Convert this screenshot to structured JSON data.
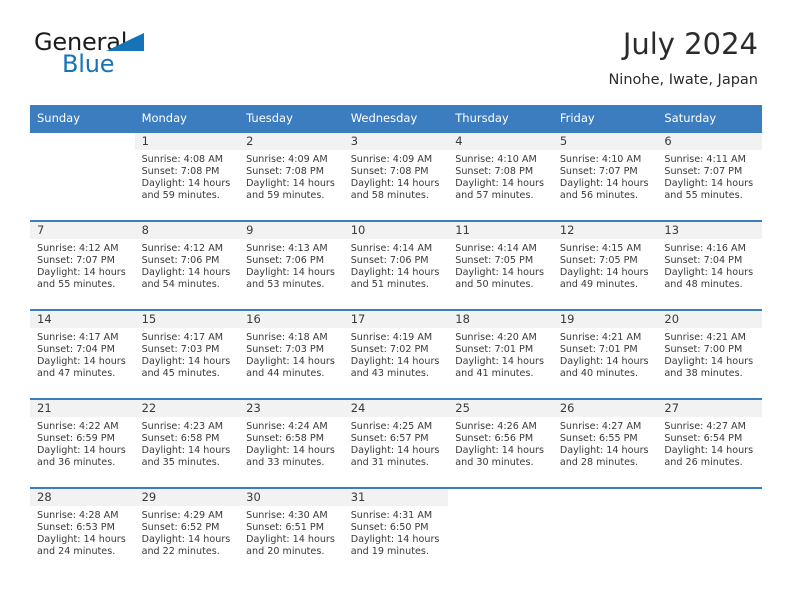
{
  "brand": {
    "line1": "General",
    "line2": "Blue",
    "triangle_icon": "triangle-icon",
    "color_dark": "#1c1c1c",
    "color_blue": "#1574b7"
  },
  "header": {
    "title": "July 2024",
    "location": "Ninohe, Iwate, Japan"
  },
  "theme": {
    "header_blue": "#3c7dc0",
    "daynum_band": "#f2f2f2",
    "text": "#3a3a3a"
  },
  "calendar": {
    "weekdays": [
      "Sunday",
      "Monday",
      "Tuesday",
      "Wednesday",
      "Thursday",
      "Friday",
      "Saturday"
    ],
    "weeks": [
      [
        {
          "day": "",
          "sunrise": "",
          "sunset": "",
          "daylight1": "",
          "daylight2": "",
          "blank": true
        },
        {
          "day": "1",
          "sunrise": "Sunrise: 4:08 AM",
          "sunset": "Sunset: 7:08 PM",
          "daylight1": "Daylight: 14 hours",
          "daylight2": "and 59 minutes."
        },
        {
          "day": "2",
          "sunrise": "Sunrise: 4:09 AM",
          "sunset": "Sunset: 7:08 PM",
          "daylight1": "Daylight: 14 hours",
          "daylight2": "and 59 minutes."
        },
        {
          "day": "3",
          "sunrise": "Sunrise: 4:09 AM",
          "sunset": "Sunset: 7:08 PM",
          "daylight1": "Daylight: 14 hours",
          "daylight2": "and 58 minutes."
        },
        {
          "day": "4",
          "sunrise": "Sunrise: 4:10 AM",
          "sunset": "Sunset: 7:08 PM",
          "daylight1": "Daylight: 14 hours",
          "daylight2": "and 57 minutes."
        },
        {
          "day": "5",
          "sunrise": "Sunrise: 4:10 AM",
          "sunset": "Sunset: 7:07 PM",
          "daylight1": "Daylight: 14 hours",
          "daylight2": "and 56 minutes."
        },
        {
          "day": "6",
          "sunrise": "Sunrise: 4:11 AM",
          "sunset": "Sunset: 7:07 PM",
          "daylight1": "Daylight: 14 hours",
          "daylight2": "and 55 minutes."
        }
      ],
      [
        {
          "day": "7",
          "sunrise": "Sunrise: 4:12 AM",
          "sunset": "Sunset: 7:07 PM",
          "daylight1": "Daylight: 14 hours",
          "daylight2": "and 55 minutes."
        },
        {
          "day": "8",
          "sunrise": "Sunrise: 4:12 AM",
          "sunset": "Sunset: 7:06 PM",
          "daylight1": "Daylight: 14 hours",
          "daylight2": "and 54 minutes."
        },
        {
          "day": "9",
          "sunrise": "Sunrise: 4:13 AM",
          "sunset": "Sunset: 7:06 PM",
          "daylight1": "Daylight: 14 hours",
          "daylight2": "and 53 minutes."
        },
        {
          "day": "10",
          "sunrise": "Sunrise: 4:14 AM",
          "sunset": "Sunset: 7:06 PM",
          "daylight1": "Daylight: 14 hours",
          "daylight2": "and 51 minutes."
        },
        {
          "day": "11",
          "sunrise": "Sunrise: 4:14 AM",
          "sunset": "Sunset: 7:05 PM",
          "daylight1": "Daylight: 14 hours",
          "daylight2": "and 50 minutes."
        },
        {
          "day": "12",
          "sunrise": "Sunrise: 4:15 AM",
          "sunset": "Sunset: 7:05 PM",
          "daylight1": "Daylight: 14 hours",
          "daylight2": "and 49 minutes."
        },
        {
          "day": "13",
          "sunrise": "Sunrise: 4:16 AM",
          "sunset": "Sunset: 7:04 PM",
          "daylight1": "Daylight: 14 hours",
          "daylight2": "and 48 minutes."
        }
      ],
      [
        {
          "day": "14",
          "sunrise": "Sunrise: 4:17 AM",
          "sunset": "Sunset: 7:04 PM",
          "daylight1": "Daylight: 14 hours",
          "daylight2": "and 47 minutes."
        },
        {
          "day": "15",
          "sunrise": "Sunrise: 4:17 AM",
          "sunset": "Sunset: 7:03 PM",
          "daylight1": "Daylight: 14 hours",
          "daylight2": "and 45 minutes."
        },
        {
          "day": "16",
          "sunrise": "Sunrise: 4:18 AM",
          "sunset": "Sunset: 7:03 PM",
          "daylight1": "Daylight: 14 hours",
          "daylight2": "and 44 minutes."
        },
        {
          "day": "17",
          "sunrise": "Sunrise: 4:19 AM",
          "sunset": "Sunset: 7:02 PM",
          "daylight1": "Daylight: 14 hours",
          "daylight2": "and 43 minutes."
        },
        {
          "day": "18",
          "sunrise": "Sunrise: 4:20 AM",
          "sunset": "Sunset: 7:01 PM",
          "daylight1": "Daylight: 14 hours",
          "daylight2": "and 41 minutes."
        },
        {
          "day": "19",
          "sunrise": "Sunrise: 4:21 AM",
          "sunset": "Sunset: 7:01 PM",
          "daylight1": "Daylight: 14 hours",
          "daylight2": "and 40 minutes."
        },
        {
          "day": "20",
          "sunrise": "Sunrise: 4:21 AM",
          "sunset": "Sunset: 7:00 PM",
          "daylight1": "Daylight: 14 hours",
          "daylight2": "and 38 minutes."
        }
      ],
      [
        {
          "day": "21",
          "sunrise": "Sunrise: 4:22 AM",
          "sunset": "Sunset: 6:59 PM",
          "daylight1": "Daylight: 14 hours",
          "daylight2": "and 36 minutes."
        },
        {
          "day": "22",
          "sunrise": "Sunrise: 4:23 AM",
          "sunset": "Sunset: 6:58 PM",
          "daylight1": "Daylight: 14 hours",
          "daylight2": "and 35 minutes."
        },
        {
          "day": "23",
          "sunrise": "Sunrise: 4:24 AM",
          "sunset": "Sunset: 6:58 PM",
          "daylight1": "Daylight: 14 hours",
          "daylight2": "and 33 minutes."
        },
        {
          "day": "24",
          "sunrise": "Sunrise: 4:25 AM",
          "sunset": "Sunset: 6:57 PM",
          "daylight1": "Daylight: 14 hours",
          "daylight2": "and 31 minutes."
        },
        {
          "day": "25",
          "sunrise": "Sunrise: 4:26 AM",
          "sunset": "Sunset: 6:56 PM",
          "daylight1": "Daylight: 14 hours",
          "daylight2": "and 30 minutes."
        },
        {
          "day": "26",
          "sunrise": "Sunrise: 4:27 AM",
          "sunset": "Sunset: 6:55 PM",
          "daylight1": "Daylight: 14 hours",
          "daylight2": "and 28 minutes."
        },
        {
          "day": "27",
          "sunrise": "Sunrise: 4:27 AM",
          "sunset": "Sunset: 6:54 PM",
          "daylight1": "Daylight: 14 hours",
          "daylight2": "and 26 minutes."
        }
      ],
      [
        {
          "day": "28",
          "sunrise": "Sunrise: 4:28 AM",
          "sunset": "Sunset: 6:53 PM",
          "daylight1": "Daylight: 14 hours",
          "daylight2": "and 24 minutes."
        },
        {
          "day": "29",
          "sunrise": "Sunrise: 4:29 AM",
          "sunset": "Sunset: 6:52 PM",
          "daylight1": "Daylight: 14 hours",
          "daylight2": "and 22 minutes."
        },
        {
          "day": "30",
          "sunrise": "Sunrise: 4:30 AM",
          "sunset": "Sunset: 6:51 PM",
          "daylight1": "Daylight: 14 hours",
          "daylight2": "and 20 minutes."
        },
        {
          "day": "31",
          "sunrise": "Sunrise: 4:31 AM",
          "sunset": "Sunset: 6:50 PM",
          "daylight1": "Daylight: 14 hours",
          "daylight2": "and 19 minutes."
        },
        {
          "day": "",
          "sunrise": "",
          "sunset": "",
          "daylight1": "",
          "daylight2": "",
          "blank": true
        },
        {
          "day": "",
          "sunrise": "",
          "sunset": "",
          "daylight1": "",
          "daylight2": "",
          "blank": true
        },
        {
          "day": "",
          "sunrise": "",
          "sunset": "",
          "daylight1": "",
          "daylight2": "",
          "blank": true
        }
      ]
    ]
  }
}
